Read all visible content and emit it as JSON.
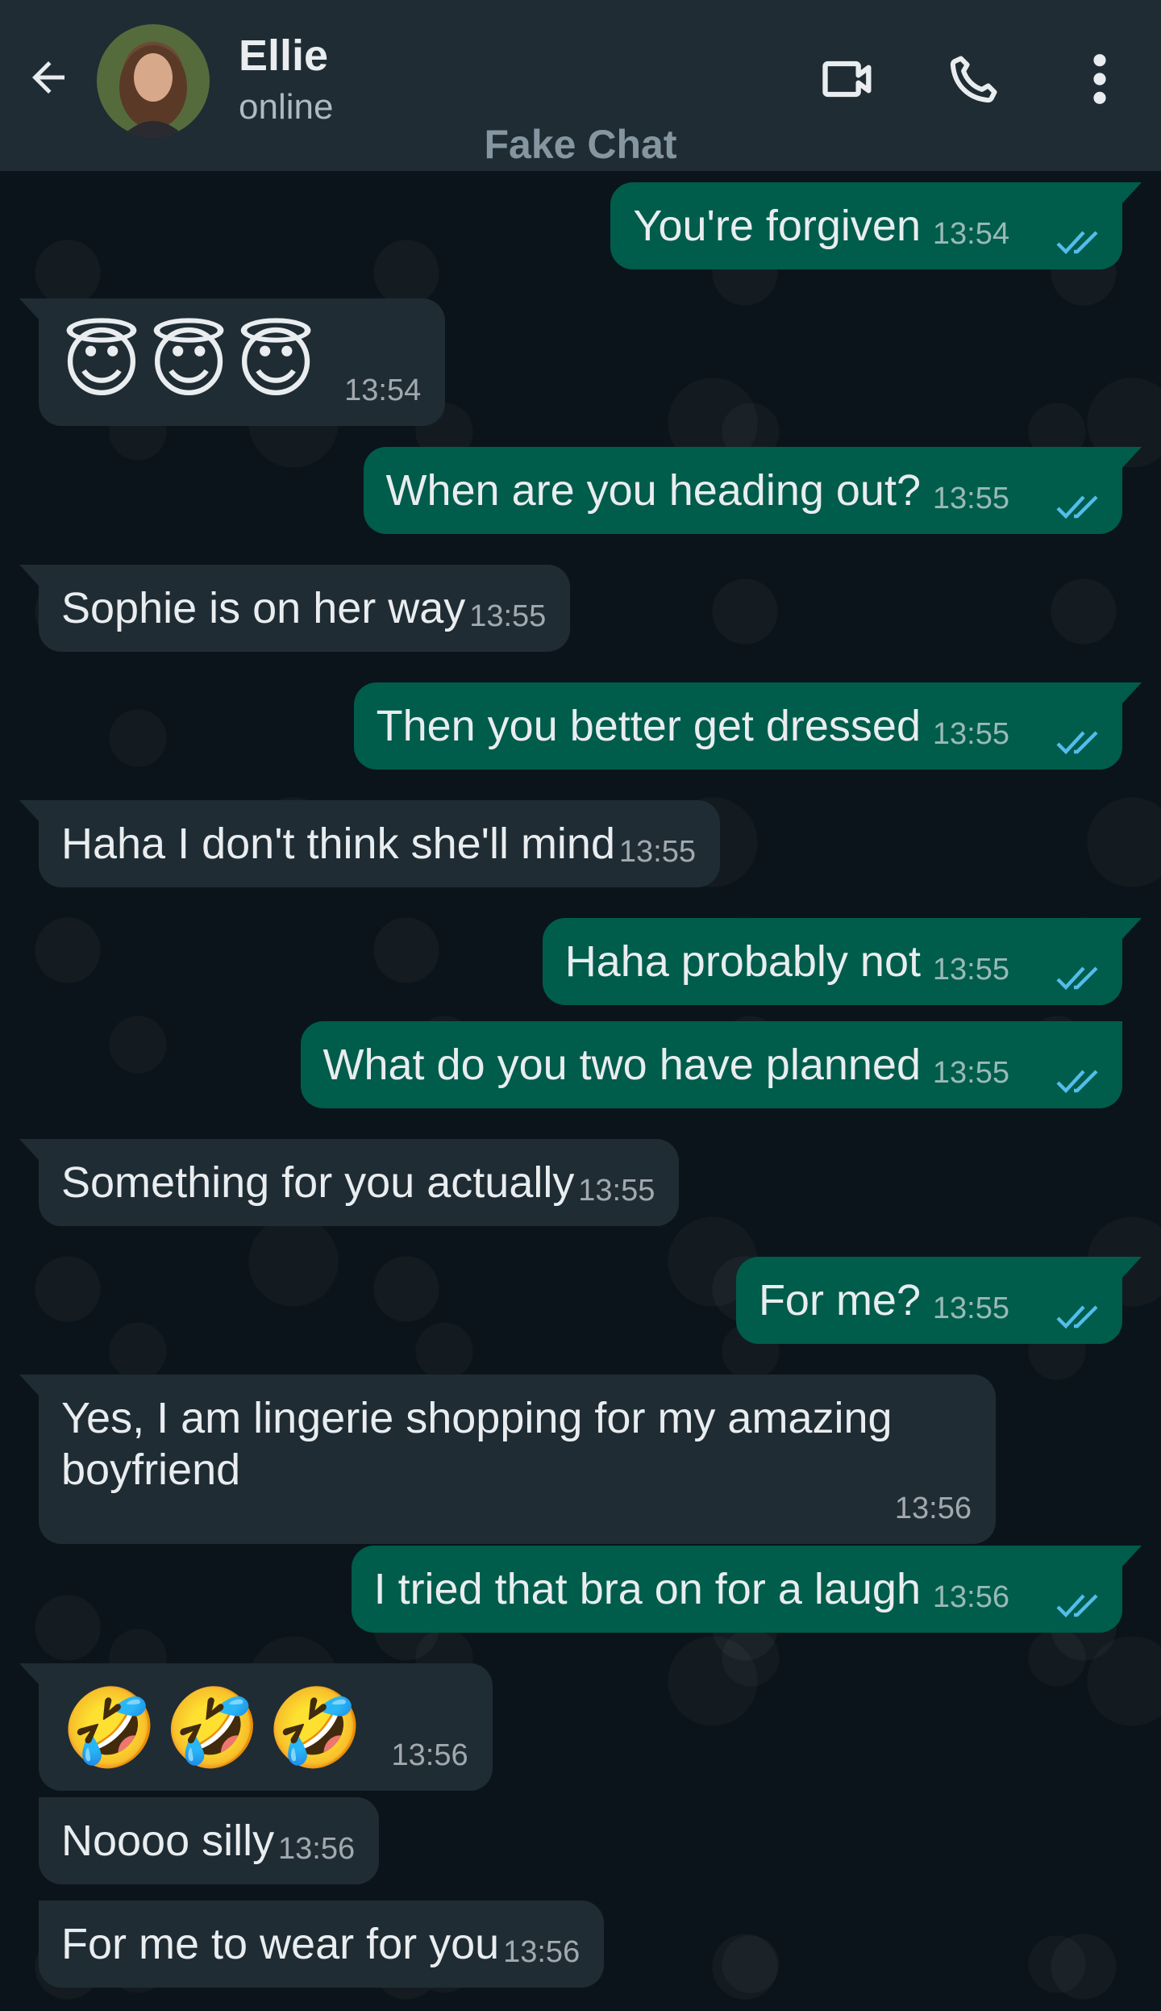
{
  "header": {
    "contact_name": "Ellie",
    "status": "online",
    "watermark": "Fake Chat",
    "icons": [
      "back-arrow-icon",
      "video-call-icon",
      "phone-icon",
      "more-vert-icon"
    ]
  },
  "colors": {
    "header_bg": "#1f2c34",
    "chat_bg": "#0b141a",
    "outgoing_bubble": "#005c4b",
    "incoming_bubble": "#1f2c34",
    "read_ticks": "#53bdeb"
  },
  "messages": [
    {
      "dir": "out",
      "text": "You're forgiven",
      "time": "13:54"
    },
    {
      "dir": "in",
      "emoji": [
        "😇",
        "😇",
        "😇"
      ],
      "time": "13:54"
    },
    {
      "dir": "out",
      "text": "When are you heading out?",
      "time": "13:55"
    },
    {
      "dir": "in",
      "text": "Sophie is on her way",
      "time": "13:55"
    },
    {
      "dir": "out",
      "text": "Then you better get dressed",
      "time": "13:55"
    },
    {
      "dir": "in",
      "text": "Haha I don't think she'll mind",
      "time": "13:55"
    },
    {
      "dir": "out",
      "text": "Haha probably not",
      "time": "13:55"
    },
    {
      "dir": "out",
      "text": "What do you two have planned",
      "time": "13:55"
    },
    {
      "dir": "in",
      "text": "Something for you actually",
      "time": "13:55"
    },
    {
      "dir": "out",
      "text": "For me?",
      "time": "13:55"
    },
    {
      "dir": "in",
      "text": "Yes, I am lingerie shopping for my amazing boyfriend",
      "time": "13:56"
    },
    {
      "dir": "out",
      "text": "I tried that bra on for a laugh",
      "time": "13:56"
    },
    {
      "dir": "in",
      "emoji": [
        "🤣",
        "🤣",
        "🤣"
      ],
      "time": "13:56"
    },
    {
      "dir": "in",
      "text": "Noooo silly",
      "time": "13:56"
    },
    {
      "dir": "in",
      "text": "For me to wear for you",
      "time": "13:56"
    }
  ]
}
